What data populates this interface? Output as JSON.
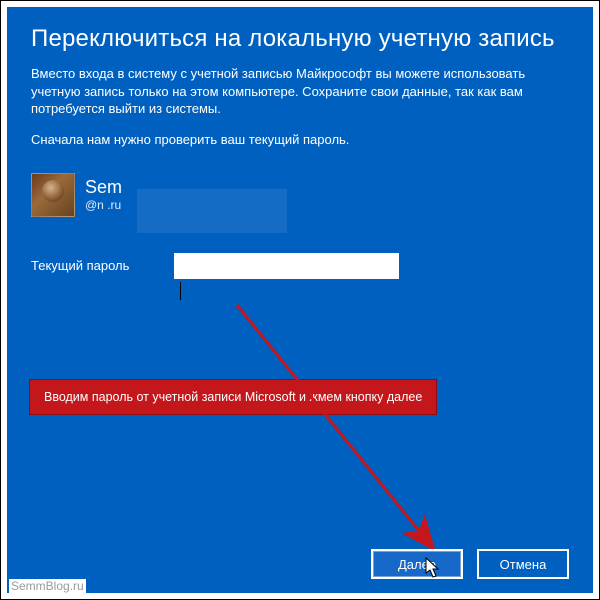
{
  "title": "Переключиться на локальную учетную запись",
  "description": "Вместо входа в систему с учетной записью Майкрософт вы можете использовать учетную запись только на этом компьютере. Сохраните свои данные, так как вам потребуется выйти из системы.",
  "description2": "Сначала нам нужно проверить ваш текущий пароль.",
  "user": {
    "name": "Sem",
    "email": "@n    .ru"
  },
  "password": {
    "label": "Текущий пароль",
    "value": ""
  },
  "annotation": "Вводим пароль от учетной записи Microsoft и жмем кнопку далее",
  "buttons": {
    "next": "Далее",
    "cancel": "Отмена"
  },
  "watermark": "SemmBlog.ru"
}
